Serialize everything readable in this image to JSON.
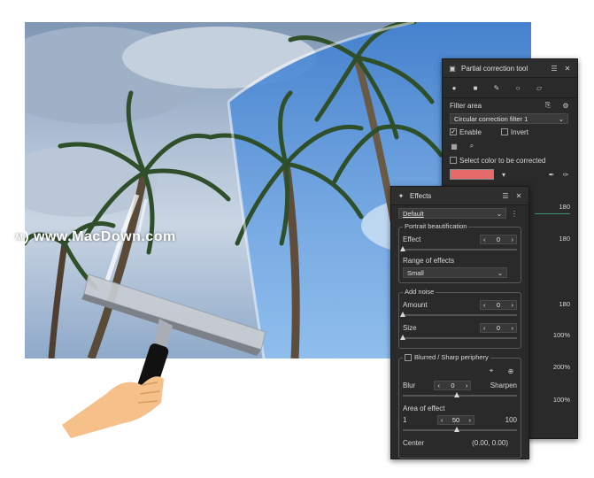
{
  "watermark": {
    "text": "www.MacDown.com",
    "logo": "M"
  },
  "partial_panel": {
    "title": "Partial correction tool",
    "filter_area_label": "Filter area",
    "filter_select": "Circular correction filter 1",
    "enable_label": "Enable",
    "invert_label": "Invert",
    "select_color_label": "Select color to be corrected",
    "color_swatch": "#e56b6b",
    "side_values": [
      "180",
      "180",
      "180",
      "100%",
      "200%",
      "100%"
    ]
  },
  "effects_panel": {
    "title": "Effects",
    "preset": "Default",
    "portrait": {
      "group_title": "Portrait beautification",
      "effect_label": "Effect",
      "effect_value": "0",
      "range_label": "Range of effects",
      "range_value": "Small"
    },
    "noise": {
      "group_title": "Add noise",
      "amount_label": "Amount",
      "amount_value": "0",
      "size_label": "Size",
      "size_value": "0"
    },
    "blur": {
      "group_title": "Blurred / Sharp periphery",
      "blur_label": "Blur",
      "blur_value": "0",
      "sharpen_label": "Sharpen",
      "area_label": "Area of effect",
      "area_min": "1",
      "area_value": "50",
      "area_max": "100",
      "center_label": "Center",
      "center_value": "(0.00, 0.00)"
    }
  }
}
